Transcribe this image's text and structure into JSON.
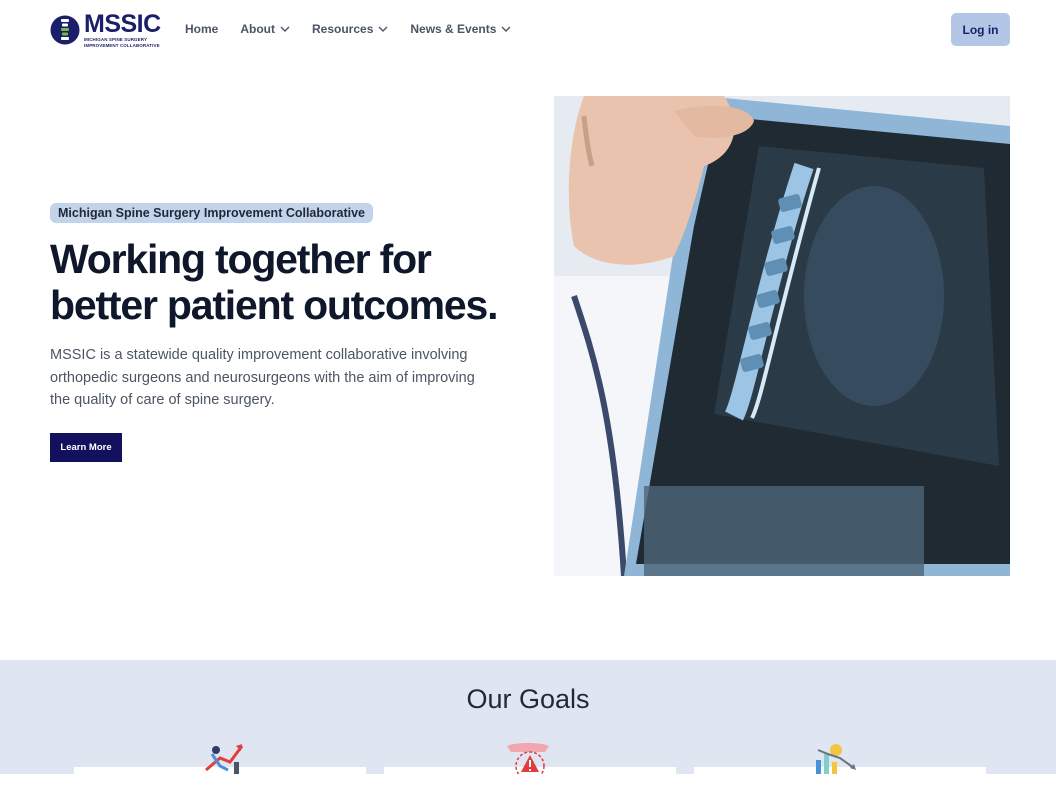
{
  "header": {
    "logo": {
      "wordmark": "MSSIC",
      "subtitle_line1": "MICHIGAN SPINE SURGERY",
      "subtitle_line2": "IMPROVEMENT COLLABORATIVE"
    },
    "nav": [
      {
        "label": "Home",
        "icon": "none"
      },
      {
        "label": "About",
        "icon": "chevron-down-icon"
      },
      {
        "label": "Resources",
        "icon": "chevron-down-icon"
      },
      {
        "label": "News & Events",
        "icon": "chevron-down-icon"
      }
    ],
    "login_label": "Log in"
  },
  "hero": {
    "badge": "Michigan Spine Surgery Improvement Collaborative",
    "title_line1": "Working together for",
    "title_line2": "better patient outcomes.",
    "description": "MSSIC is a statewide quality improvement collaborative involving orthopedic surgeons and neurosurgeons with the aim of improving the quality of care of spine surgery.",
    "cta_label": "Learn More",
    "image": "photo of hand holding spine MRI film"
  },
  "goals": {
    "title": "Our Goals",
    "icons": [
      "growth-chart-icon",
      "warning-shield-icon",
      "cost-reduction-icon"
    ]
  },
  "colors": {
    "brand_navy": "#13105e",
    "badge_bg": "#c4d3ec",
    "login_bg": "#b4c6e6",
    "goals_bg": "#dfe6f2"
  }
}
